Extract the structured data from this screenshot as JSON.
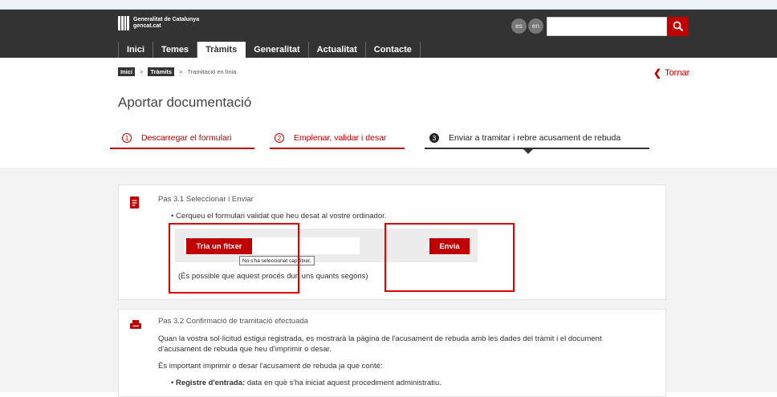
{
  "header": {
    "logo_line1": "Generalitat de Catalunya",
    "logo_line2": "gencat.cat",
    "lang": [
      "es",
      "en"
    ],
    "search_placeholder": ""
  },
  "nav": [
    {
      "label": "Inici",
      "active": false
    },
    {
      "label": "Temes",
      "active": false
    },
    {
      "label": "Tràmits",
      "active": true
    },
    {
      "label": "Generalitat",
      "active": false
    },
    {
      "label": "Actualitat",
      "active": false
    },
    {
      "label": "Contacte",
      "active": false
    }
  ],
  "breadcrumb": [
    "Inici",
    "Tràmits",
    "Tramitació en línia"
  ],
  "back_label": "Tornar",
  "page_title": "Aportar documentació",
  "steps": [
    {
      "num": "1",
      "label": "Descarregar el formulari"
    },
    {
      "num": "2",
      "label": "Emplenar, validar i desar"
    },
    {
      "num": "3",
      "label": "Enviar a tramitar i rebre acusament de rebuda"
    }
  ],
  "card1": {
    "title": "Pas 3.1 Seleccionar i Enviar",
    "bullet": "Cerqueu el formulari validat que heu desat al vostre ordinador.",
    "choose_label": "Tria un fitxer",
    "send_label": "Envia",
    "tooltip": "No s'ha seleccionat cap fitxer.",
    "note": "(És possible que aquest procés duri uns quants segons)"
  },
  "card2": {
    "title": "Pas 3.2 Confirmació de tramitació efectuada",
    "para1_line1": "Quan la vostra sol·licitud estigui registrada, es mostrarà la pàgina de l'acusament de rebuda amb les dades del tràmit i el document",
    "para1_line2": "d'acusament de rebuda que heu d'imprimir o desar.",
    "para2": "És important imprimir o desar l'acusament de rebuda ja que conté:",
    "bullet_bold": "Registre d'entrada:",
    "bullet_text": "data en què s'ha iniciat aquest procediment administratiu."
  },
  "colors": {
    "brand_red": "#c00000",
    "header_bg": "#333333",
    "highlight": "#e00000"
  }
}
